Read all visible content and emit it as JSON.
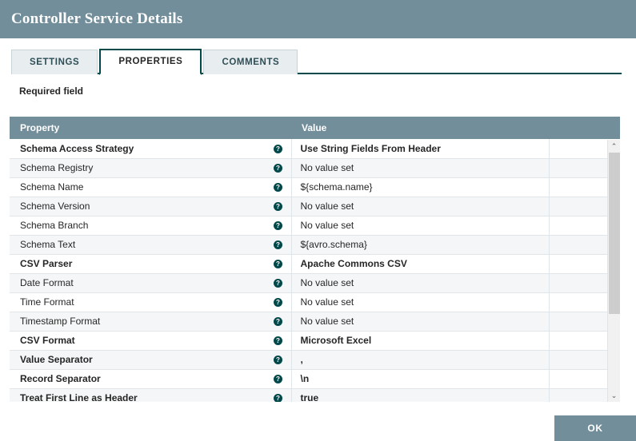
{
  "window": {
    "title": "Controller Service Details"
  },
  "tabs": [
    {
      "label": "SETTINGS",
      "active": false
    },
    {
      "label": "PROPERTIES",
      "active": true
    },
    {
      "label": "COMMENTS",
      "active": false
    }
  ],
  "notes": {
    "required_field": "Required field"
  },
  "table": {
    "headers": {
      "property": "Property",
      "value": "Value"
    },
    "help_icon": "help-circle-icon",
    "help_glyph": "?",
    "rows": [
      {
        "property": "Schema Access Strategy",
        "required": true,
        "value": "Use String Fields From Header",
        "value_set": true
      },
      {
        "property": "Schema Registry",
        "required": false,
        "value": "No value set",
        "value_set": false
      },
      {
        "property": "Schema Name",
        "required": false,
        "value": "${schema.name}",
        "value_set": true
      },
      {
        "property": "Schema Version",
        "required": false,
        "value": "No value set",
        "value_set": false
      },
      {
        "property": "Schema Branch",
        "required": false,
        "value": "No value set",
        "value_set": false
      },
      {
        "property": "Schema Text",
        "required": false,
        "value": "${avro.schema}",
        "value_set": true
      },
      {
        "property": "CSV Parser",
        "required": true,
        "value": "Apache Commons CSV",
        "value_set": true
      },
      {
        "property": "Date Format",
        "required": false,
        "value": "No value set",
        "value_set": false
      },
      {
        "property": "Time Format",
        "required": false,
        "value": "No value set",
        "value_set": false
      },
      {
        "property": "Timestamp Format",
        "required": false,
        "value": "No value set",
        "value_set": false
      },
      {
        "property": "CSV Format",
        "required": true,
        "value": "Microsoft Excel",
        "value_set": true
      },
      {
        "property": "Value Separator",
        "required": true,
        "value": ",",
        "value_set": true
      },
      {
        "property": "Record Separator",
        "required": true,
        "value": "\\n",
        "value_set": true
      },
      {
        "property": "Treat First Line as Header",
        "required": true,
        "value": "true",
        "value_set": true
      }
    ]
  },
  "scrollbar": {
    "up_arrow": "chevron-up-icon",
    "down_arrow": "chevron-down-icon",
    "up_glyph": "⌃",
    "down_glyph": "⌄"
  },
  "footer": {
    "ok_label": "OK"
  },
  "colors": {
    "header_bar": "#728e9b",
    "accent": "#004849",
    "table_header": "#728e9b",
    "row_alt": "#f4f6f7",
    "unset_text": "#a6adb2",
    "ok_button": "#728e9b"
  }
}
